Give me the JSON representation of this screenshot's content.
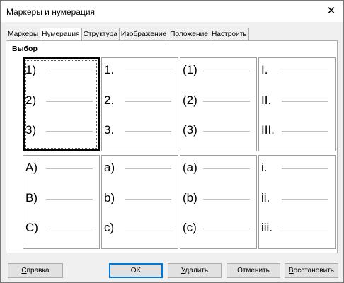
{
  "window": {
    "title": "Маркеры и нумерация",
    "close": "✕"
  },
  "tabs": [
    {
      "label": "Маркеры",
      "active": false
    },
    {
      "label": "Нумерация",
      "active": true
    },
    {
      "label": "Структура",
      "active": false
    },
    {
      "label": "Изображение",
      "active": false
    },
    {
      "label": "Положение",
      "active": false
    },
    {
      "label": "Настроить",
      "active": false
    }
  ],
  "section": {
    "label": "Выбор"
  },
  "styles": [
    {
      "items": [
        "1)",
        "2)",
        "3)"
      ],
      "selected": true
    },
    {
      "items": [
        "1.",
        "2.",
        "3."
      ],
      "selected": false
    },
    {
      "items": [
        "(1)",
        "(2)",
        "(3)"
      ],
      "selected": false
    },
    {
      "items": [
        "I.",
        "II.",
        "III."
      ],
      "selected": false
    },
    {
      "items": [
        "A)",
        "B)",
        "C)"
      ],
      "selected": false
    },
    {
      "items": [
        "a)",
        "b)",
        "c)"
      ],
      "selected": false
    },
    {
      "items": [
        "(a)",
        "(b)",
        "(c)"
      ],
      "selected": false
    },
    {
      "items": [
        "i.",
        "ii.",
        "iii."
      ],
      "selected": false
    }
  ],
  "buttons": {
    "help": {
      "first": "С",
      "rest": "правка"
    },
    "ok": "OK",
    "delete": {
      "first": "У",
      "rest": "далить"
    },
    "cancel": "Отменить",
    "reset": {
      "first": "В",
      "rest": "осстановить"
    }
  }
}
